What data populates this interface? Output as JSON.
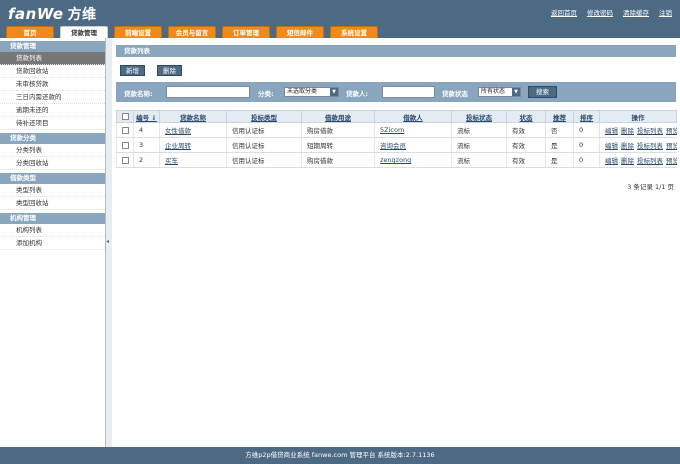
{
  "logo": {
    "brand": "fanWe",
    "cn": "方维"
  },
  "top_links": [
    "返回首页",
    "修改密码",
    "清除缓存",
    "注销"
  ],
  "nav_tabs": [
    {
      "label": "首页",
      "active": false
    },
    {
      "label": "贷款管理",
      "active": true
    },
    {
      "label": "前端设置",
      "active": false
    },
    {
      "label": "会员与留言",
      "active": false
    },
    {
      "label": "订单管理",
      "active": false
    },
    {
      "label": "短信邮件",
      "active": false
    },
    {
      "label": "系统设置",
      "active": false
    }
  ],
  "sidebar": {
    "groups": [
      {
        "title": "贷款管理",
        "items": [
          "贷款列表",
          "贷款回收站",
          "未审核贷款",
          "三日内需还款的",
          "逾期未还的",
          "待补还项目"
        ]
      },
      {
        "title": "贷款分类",
        "items": [
          "分类列表",
          "分类回收站"
        ]
      },
      {
        "title": "借款类型",
        "items": [
          "类型列表",
          "类型回收站"
        ]
      },
      {
        "title": "机构管理",
        "items": [
          "机构列表",
          "添加机构"
        ]
      }
    ],
    "active_item": "贷款列表"
  },
  "main": {
    "panel_title": "贷款列表",
    "add_button": "新增",
    "delete_button": "删除",
    "search": {
      "name_label": "贷款名称:",
      "category_label": "分类:",
      "category_selected": "未选取分类",
      "borrower_label": "贷款人:",
      "status_label": "贷款状态",
      "status_selected": "所有状态",
      "search_button": "搜索"
    },
    "table": {
      "headers": [
        "编号",
        "贷款名称",
        "投标类型",
        "借款用途",
        "借款人",
        "投标状态",
        "状态",
        "推荐",
        "排序",
        "操作"
      ],
      "rows": [
        {
          "id": "4",
          "name": "女性借款",
          "bid_type": "信用认证标",
          "purpose": "购房借款",
          "borrower": "5Zicom",
          "bid_status": "流标",
          "status": "有效",
          "recommend": "否",
          "sort": "0"
        },
        {
          "id": "3",
          "name": "企业周转",
          "bid_type": "信用认证标",
          "purpose": "短期周转",
          "borrower": "咨询会员",
          "bid_status": "流标",
          "status": "有效",
          "recommend": "是",
          "sort": "0"
        },
        {
          "id": "2",
          "name": "买车",
          "bid_type": "信用认证标",
          "purpose": "购房借款",
          "borrower": "zengzong",
          "bid_status": "流标",
          "status": "有效",
          "recommend": "是",
          "sort": "0"
        }
      ],
      "row_actions": [
        "编辑",
        "删除",
        "投标列表",
        "预览"
      ]
    },
    "pager": "3 条记录 1/1 页"
  },
  "footer": "方维p2p借贷商业系统 fanwe.com 管理平台 系统版本:2.7.1136"
}
